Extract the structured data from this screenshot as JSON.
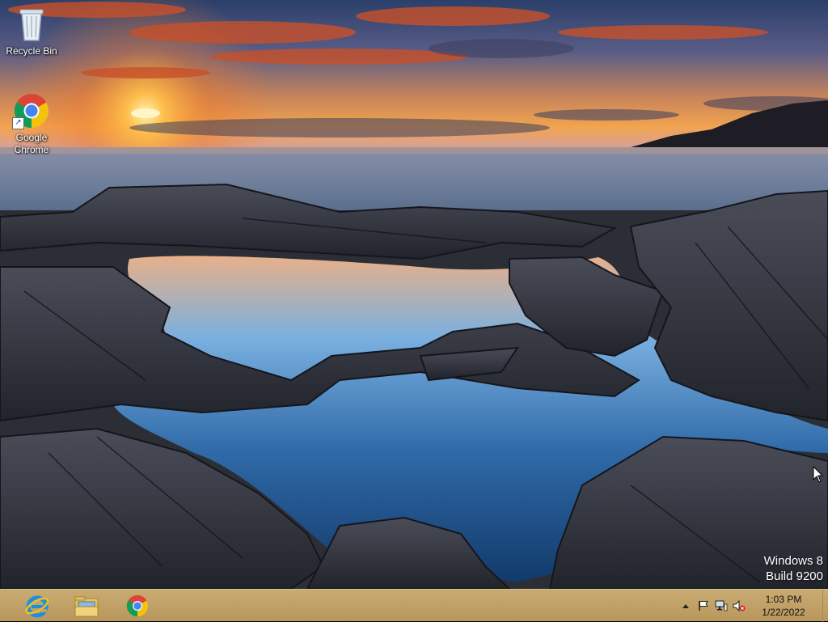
{
  "desktop": {
    "icons": [
      {
        "label": "Recycle Bin",
        "icon": "recycle-bin-icon"
      },
      {
        "label": "Google\nChrome",
        "icon": "chrome-icon"
      }
    ]
  },
  "watermark": {
    "line1": "Windows 8",
    "line2": "Build 9200"
  },
  "taskbar": {
    "pinned": [
      {
        "name": "Internet Explorer",
        "icon": "internet-explorer-icon"
      },
      {
        "name": "File Explorer",
        "icon": "folder-icon"
      },
      {
        "name": "Google Chrome",
        "icon": "chrome-icon"
      }
    ],
    "tray": {
      "icons": [
        "chevron-up-icon",
        "flag-icon",
        "network-icon",
        "speaker-muted-icon"
      ],
      "time": "1:03 PM",
      "date": "1/22/2022"
    }
  },
  "colors": {
    "taskbar": "#c0a066",
    "text": "#ffffff"
  }
}
